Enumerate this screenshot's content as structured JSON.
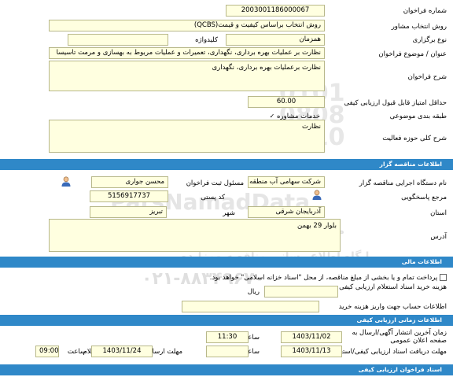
{
  "general": {
    "tender_number_label": "شماره فراخوان",
    "tender_number": "2003001186000067",
    "consultant_method_label": "روش انتخاب مشاور",
    "consultant_method": "روش انتخاب براساس کیفیت و قیمت(QCBS)",
    "meeting_type_label": "نوع برگزاری",
    "meeting_type": "همزمان",
    "keyword_label": "کلیدواژه",
    "keyword": "",
    "subject_label": "عنوان / موضوع فراخوان",
    "subject": "نظارت بر عملیات بهره برداری، نگهداری، تعمیرات و عملیات مربوط به بهسازی و مرمت تاسیسا",
    "description_label": "شرح فراخوان",
    "description": "نظارت برعملیات بهره برداری، نگهداری",
    "min_score_label": "حداقل امتیاز قابل قبول ارزیابی کیفی",
    "min_score": "60.00",
    "category_label": "طبقه بندی موضوعی",
    "category_item": "خدمات مشاوره",
    "activity_label": "شرح کلی حوزه فعالیت",
    "activity": "نظارت"
  },
  "organizer": {
    "section_title": "اطلاعات مناقصه گزار",
    "org_name_label": "نام دستگاه اجرایی مناقصه گزار",
    "org_name": "شرکت سهامی آب منطقه ای",
    "official_label": "مسئول ثبت فراخوان",
    "official": "محسن جواری",
    "reference_label": "مرجع پاسخگویی",
    "postal_code_label": "کد پستی",
    "postal_code": "5156917737",
    "province_label": "استان",
    "province": "آذربایجان شرقی",
    "city_label": "شهر",
    "city": "تبریز",
    "address_label": "آدرس",
    "address": "بلوار 29 بهمن"
  },
  "financial": {
    "section_title": "اطلاعات مالی",
    "treasury_text": "پرداخت تمام و یا بخشی از مبلغ مناقصه، از محل \"اسناد خزانه اسلامی\" خواهد بود.",
    "doc_fee_label": "هزینه خرید اسناد استعلام ارزیابی کیفی",
    "doc_fee_value": "",
    "currency": "ریال",
    "account_label": "اطلاعات حساب جهت واریز هزینه خرید",
    "account_value": ""
  },
  "timing": {
    "section_title": "اطلاعات زمانی ارزیابی کیفی",
    "last_publish_label": "زمان آخرین انتشار آگهی/ارسال به صفحه اعلان عمومی",
    "last_publish_date": "1403/11/02",
    "time_label": "ساعت",
    "last_publish_time": "11:30",
    "receive_deadline_label": "مهلت دریافت اسناد ارزیابی کیفی/استعلام",
    "receive_deadline_date": "1403/11/13",
    "receive_deadline_time": "",
    "reply_deadline_label": "مهلت ارسال پاسخ فراخوان/استعلام",
    "reply_deadline_date": "1403/11/24",
    "reply_deadline_time": "09:00"
  },
  "documents": {
    "section_title": "اسناد فراخوان ارزیابی کیفی"
  },
  "watermark": {
    "brand_latin": "ParsNamadData",
    "brand_fa": "مرکز فناوری اطلاعات پارس نماد داده ها",
    "portal_fa": "پایگاه اطلاع رسانی مناقصه ومزایده",
    "phone": "۰۲۱-۸۸۳۴۹۶۷۰"
  },
  "colors": {
    "section_bar": "#2f88c8",
    "field_bg": "#ffffe0"
  }
}
